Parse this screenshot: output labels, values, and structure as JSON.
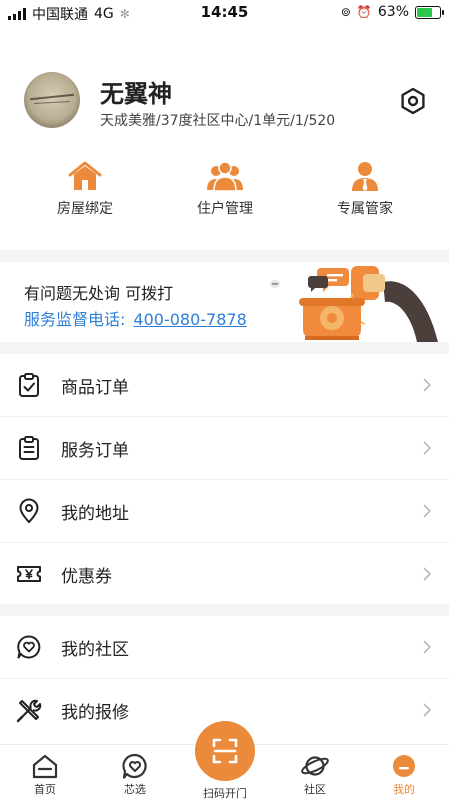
{
  "status_bar": {
    "carrier": "中国联通",
    "network": "4G",
    "time": "14:45",
    "battery": "63%",
    "battery_level": 0.63
  },
  "profile": {
    "name": "无翼神",
    "address": "天成美雅/37度社区中心/1单元/1/520",
    "settings_icon": "hexagon-settings-icon"
  },
  "quick_actions": [
    {
      "label": "房屋绑定",
      "icon": "house-icon"
    },
    {
      "label": "住户管理",
      "icon": "residents-icon"
    },
    {
      "label": "专属管家",
      "icon": "butler-icon"
    }
  ],
  "banner": {
    "line1": "有问题无处询 可拨打",
    "line2_prefix": "服务监督电话:",
    "phone": "400-080-7878",
    "illustration": "telephone-illustration"
  },
  "menu_group_1": [
    {
      "label": "商品订单",
      "icon": "clipboard-check-icon"
    },
    {
      "label": "服务订单",
      "icon": "clipboard-list-icon"
    },
    {
      "label": "我的地址",
      "icon": "location-pin-icon"
    },
    {
      "label": "优惠券",
      "icon": "coupon-yen-icon"
    }
  ],
  "menu_group_2": [
    {
      "label": "我的社区",
      "icon": "heart-chat-icon"
    },
    {
      "label": "我的报修",
      "icon": "tools-icon"
    }
  ],
  "tab_bar": {
    "items": [
      {
        "label": "首页",
        "icon": "home-icon"
      },
      {
        "label": "芯选",
        "icon": "heart-bubble-icon"
      },
      {
        "label": "扫码开门",
        "icon": "scan-icon"
      },
      {
        "label": "社区",
        "icon": "planet-icon"
      },
      {
        "label": "我的",
        "icon": "profile-icon"
      }
    ],
    "active": "我的"
  },
  "colors": {
    "accent": "#ea8a3a",
    "link": "#2f7fd6",
    "divider": "#f4f4f4"
  }
}
